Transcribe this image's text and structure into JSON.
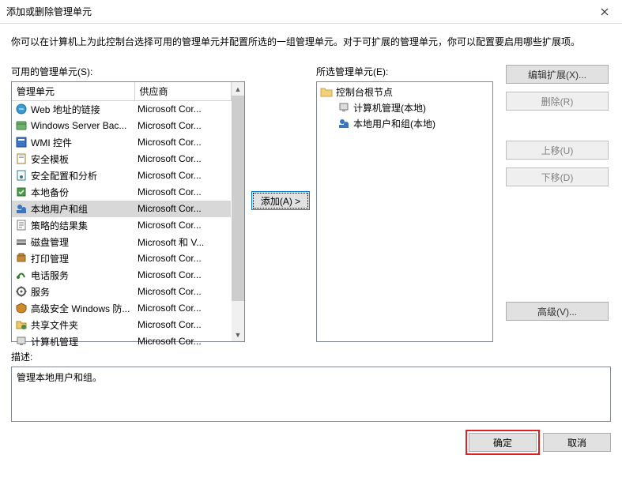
{
  "dialog": {
    "title": "添加或删除管理单元",
    "intro": "你可以在计算机上为此控制台选择可用的管理单元并配置所选的一组管理单元。对于可扩展的管理单元，你可以配置要启用哪些扩展项。"
  },
  "available": {
    "label": "可用的管理单元(S):",
    "columns": {
      "snapin": "管理单元",
      "vendor": "供应商"
    },
    "items": [
      {
        "name": "Web 地址的链接",
        "vendor": "Microsoft Cor...",
        "selected": false
      },
      {
        "name": "Windows Server Bac...",
        "vendor": "Microsoft Cor...",
        "selected": false
      },
      {
        "name": "WMI 控件",
        "vendor": "Microsoft Cor...",
        "selected": false
      },
      {
        "name": "安全模板",
        "vendor": "Microsoft Cor...",
        "selected": false
      },
      {
        "name": "安全配置和分析",
        "vendor": "Microsoft Cor...",
        "selected": false
      },
      {
        "name": "本地备份",
        "vendor": "Microsoft Cor...",
        "selected": false
      },
      {
        "name": "本地用户和组",
        "vendor": "Microsoft Cor...",
        "selected": true
      },
      {
        "name": "策略的结果集",
        "vendor": "Microsoft Cor...",
        "selected": false
      },
      {
        "name": "磁盘管理",
        "vendor": "Microsoft 和 V...",
        "selected": false
      },
      {
        "name": "打印管理",
        "vendor": "Microsoft Cor...",
        "selected": false
      },
      {
        "name": "电话服务",
        "vendor": "Microsoft Cor...",
        "selected": false
      },
      {
        "name": "服务",
        "vendor": "Microsoft Cor...",
        "selected": false
      },
      {
        "name": "高级安全 Windows 防...",
        "vendor": "Microsoft Cor...",
        "selected": false
      },
      {
        "name": "共享文件夹",
        "vendor": "Microsoft Cor...",
        "selected": false
      },
      {
        "name": "计算机管理",
        "vendor": "Microsoft Cor...",
        "selected": false
      }
    ]
  },
  "add_button_label": "添加(A) >",
  "selected": {
    "label": "所选管理单元(E):",
    "root": "控制台根节点",
    "children": [
      "计算机管理(本地)",
      "本地用户和组(本地)"
    ]
  },
  "side_buttons": {
    "edit_ext": "编辑扩展(X)...",
    "delete": "删除(R)",
    "move_up": "上移(U)",
    "move_down": "下移(D)",
    "advanced": "高级(V)..."
  },
  "description": {
    "label": "描述:",
    "text": "管理本地用户和组。"
  },
  "bottom": {
    "ok": "确定",
    "cancel": "取消"
  }
}
